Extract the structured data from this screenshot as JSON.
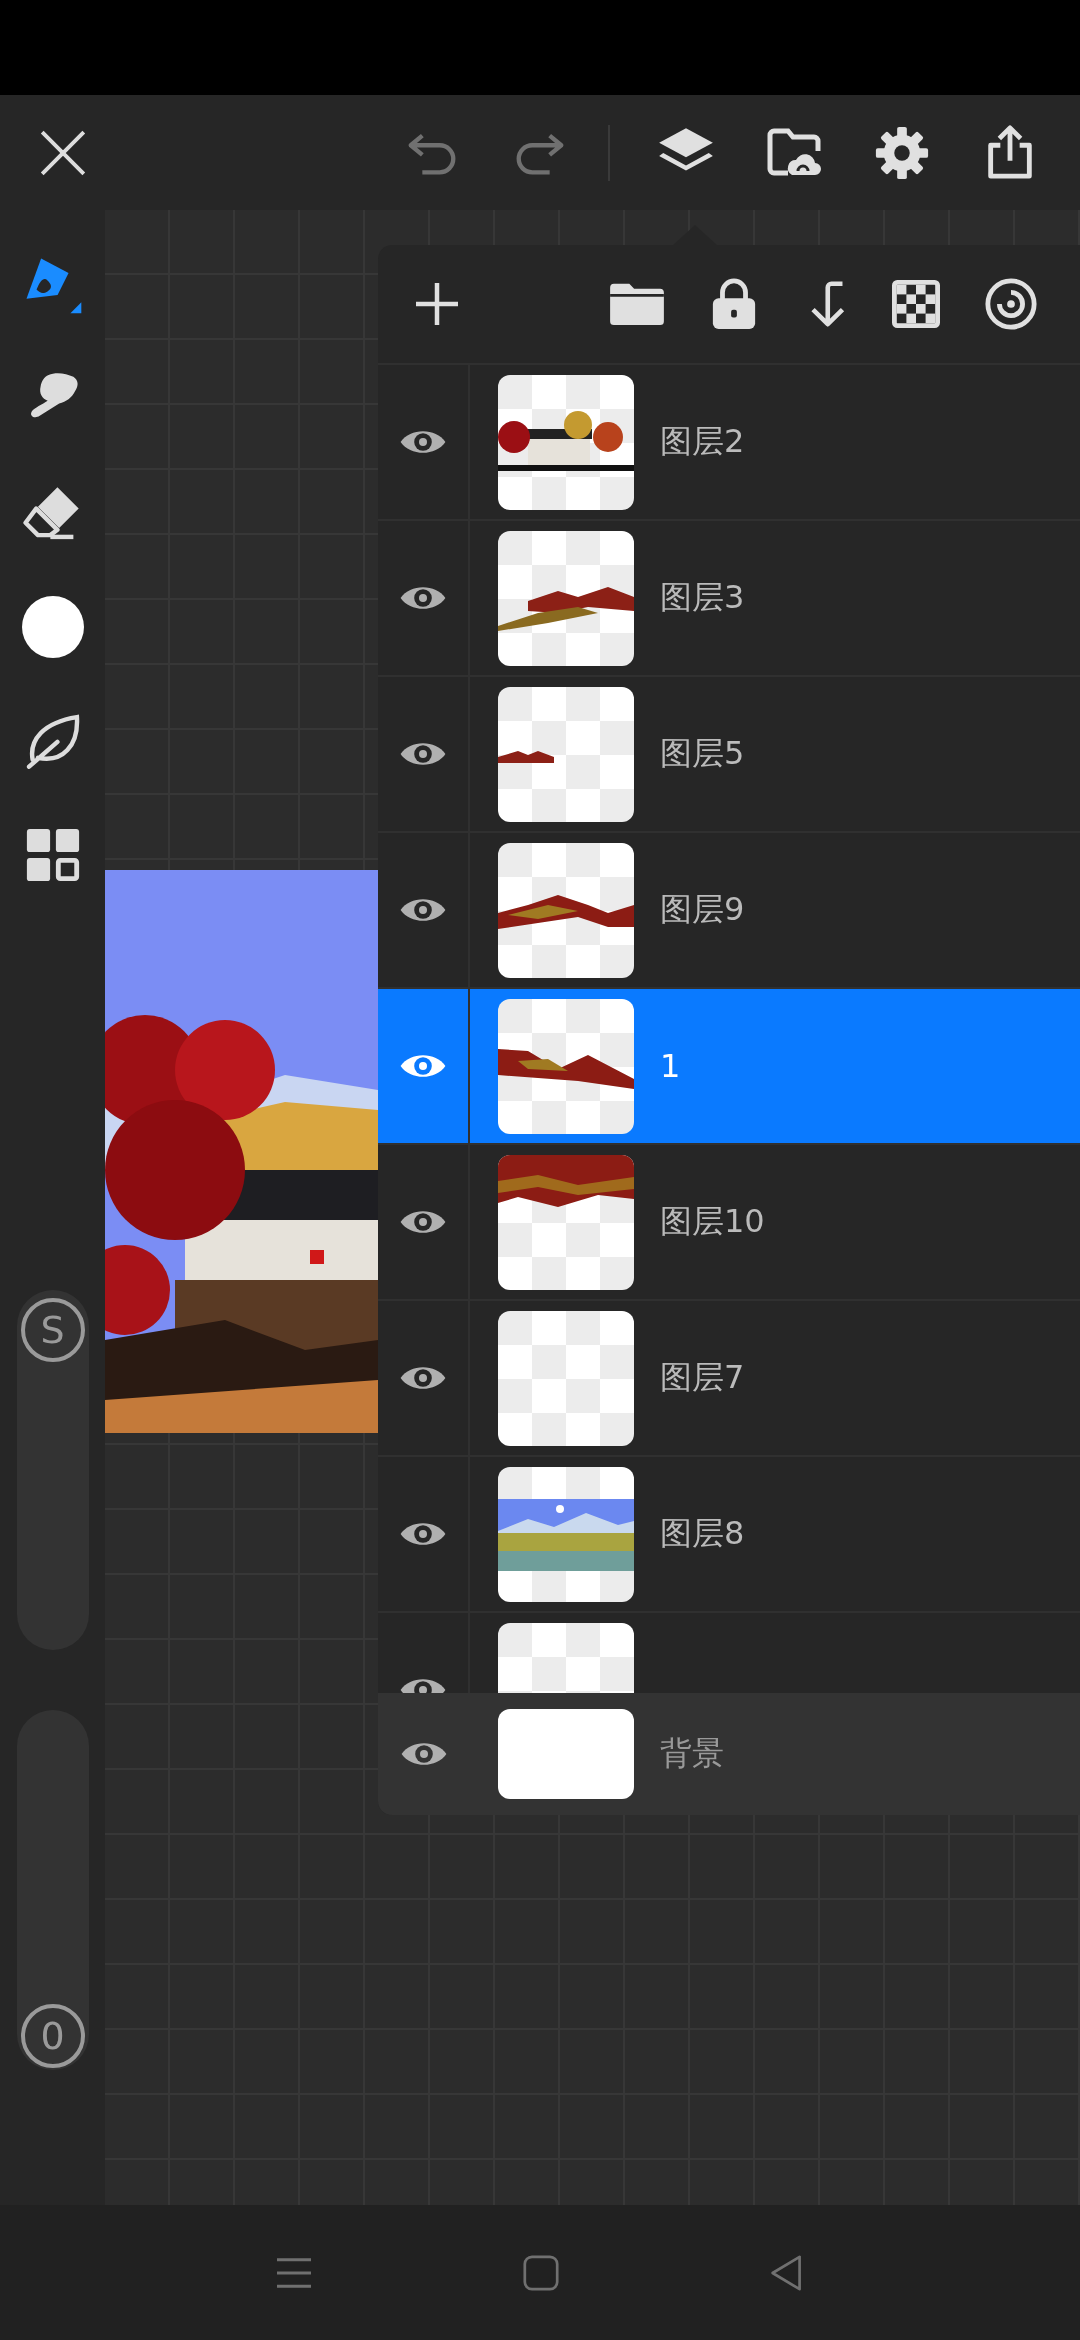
{
  "top_bar": {
    "undo": {
      "disabled": true
    },
    "redo": {
      "disabled": true
    }
  },
  "tools": [
    {
      "kind": "pen",
      "selected": true
    },
    {
      "kind": "smudge",
      "selected": false
    },
    {
      "kind": "eraser",
      "selected": false
    },
    {
      "kind": "color",
      "selected": false,
      "color": "#ffffff"
    },
    {
      "kind": "leaf",
      "selected": false
    },
    {
      "kind": "grid",
      "selected": false
    }
  ],
  "sliders": [
    {
      "label": "S",
      "level": 1
    },
    {
      "label": "0",
      "level": 0
    }
  ],
  "layers_panel": {
    "layers": [
      {
        "name": "图层2",
        "visible": true,
        "selected": false
      },
      {
        "name": "图层3",
        "visible": true,
        "selected": false
      },
      {
        "name": "图层5",
        "visible": true,
        "selected": false
      },
      {
        "name": "图层9",
        "visible": true,
        "selected": false
      },
      {
        "name": "1",
        "visible": true,
        "selected": true
      },
      {
        "name": "图层10",
        "visible": true,
        "selected": false
      },
      {
        "name": "图层7",
        "visible": true,
        "selected": false
      },
      {
        "name": "图层8",
        "visible": true,
        "selected": false
      },
      {
        "visible": true,
        "selected": false
      }
    ],
    "background": {
      "name": "背景",
      "visible": true
    }
  }
}
